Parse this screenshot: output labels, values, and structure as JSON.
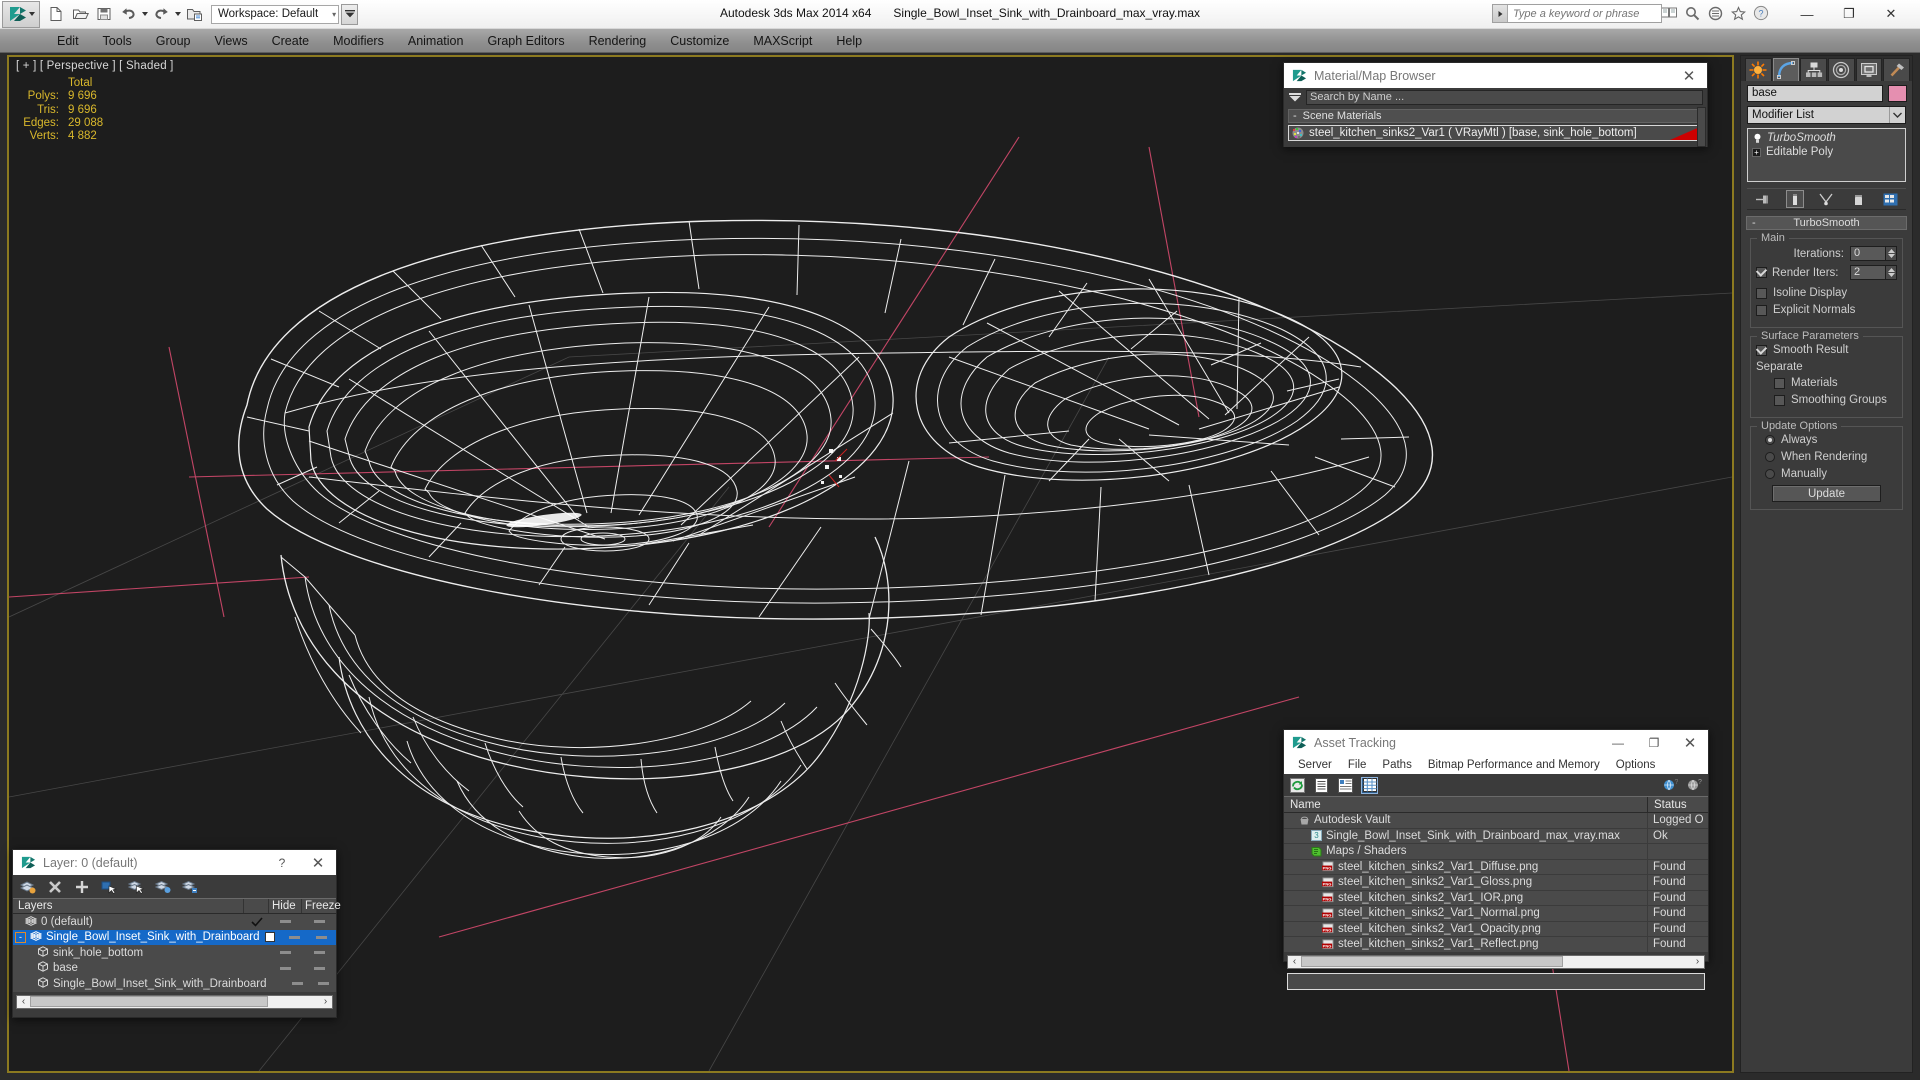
{
  "titlebar": {
    "app_title": "Autodesk 3ds Max  2014 x64",
    "file_name": "Single_Bowl_Inset_Sink_with_Drainboard_max_vray.max",
    "workspace_label": "Workspace: Default",
    "search_placeholder": "Type a keyword or phrase",
    "quick_access": [
      {
        "name": "new-file-icon",
        "label": "New"
      },
      {
        "name": "open-file-icon",
        "label": "Open"
      },
      {
        "name": "save-file-icon",
        "label": "Save"
      },
      {
        "name": "undo-icon",
        "label": "Undo"
      },
      {
        "name": "undo-dropdown-icon",
        "label": "Undo list"
      },
      {
        "name": "redo-icon",
        "label": "Redo"
      },
      {
        "name": "redo-dropdown-icon",
        "label": "Redo list"
      },
      {
        "name": "set-project-folder-icon",
        "label": "Set Project Folder"
      }
    ],
    "window_controls": [
      {
        "name": "minimize-button",
        "glyph": "—"
      },
      {
        "name": "maximize-button",
        "glyph": "❐"
      },
      {
        "name": "close-button",
        "glyph": "✕"
      }
    ]
  },
  "menubar": {
    "items": [
      "Edit",
      "Tools",
      "Group",
      "Views",
      "Create",
      "Modifiers",
      "Animation",
      "Graph Editors",
      "Rendering",
      "Customize",
      "MAXScript",
      "Help"
    ]
  },
  "viewport": {
    "label": "[ + ] [ Perspective ] [ Shaded ]",
    "stats_header": "Total",
    "stats": [
      {
        "label": "Polys:",
        "value": "9 696"
      },
      {
        "label": "Tris:",
        "value": "9 696"
      },
      {
        "label": "Edges:",
        "value": "29 088"
      },
      {
        "label": "Verts:",
        "value": "4 882"
      }
    ],
    "border_color": "#8c7a20",
    "background_color": "#1d1d1d",
    "wire_color": "#ffffff"
  },
  "command_panel": {
    "tabs": [
      {
        "name": "create-tab",
        "label": "Create",
        "active": false
      },
      {
        "name": "modify-tab",
        "label": "Modify",
        "active": true
      },
      {
        "name": "hierarchy-tab",
        "label": "Hierarchy",
        "active": false
      },
      {
        "name": "motion-tab",
        "label": "Motion",
        "active": false
      },
      {
        "name": "display-tab",
        "label": "Display",
        "active": false
      },
      {
        "name": "utilities-tab",
        "label": "Utilities",
        "active": false
      }
    ],
    "object_name": "base",
    "object_color": "#e58fb0",
    "modifier_list_label": "Modifier List",
    "modifier_stack": [
      {
        "label": "TurboSmooth",
        "italic": true
      },
      {
        "label": "Editable Poly",
        "italic": false
      }
    ],
    "stack_tools": [
      {
        "name": "pin-stack-icon"
      },
      {
        "name": "show-end-result-icon"
      },
      {
        "name": "make-unique-icon"
      },
      {
        "name": "remove-modifier-icon"
      },
      {
        "name": "configure-modifier-sets-icon"
      }
    ],
    "turbosmooth": {
      "rollout_title": "TurboSmooth",
      "main_group": "Main",
      "iterations_label": "Iterations:",
      "iterations_value": "0",
      "render_iters_label": "Render Iters:",
      "render_iters_value": "2",
      "render_iters_checked": true,
      "isoline_display_label": "Isoline Display",
      "isoline_display_checked": false,
      "explicit_normals_label": "Explicit Normals",
      "explicit_normals_checked": false,
      "surface_group": "Surface Parameters",
      "smooth_result_label": "Smooth Result",
      "smooth_result_checked": true,
      "separate_label": "Separate",
      "materials_label": "Materials",
      "materials_checked": false,
      "smoothing_groups_label": "Smoothing Groups",
      "smoothing_groups_checked": false,
      "update_group": "Update Options",
      "update_options": [
        {
          "label": "Always",
          "selected": true
        },
        {
          "label": "When Rendering",
          "selected": false
        },
        {
          "label": "Manually",
          "selected": false
        }
      ],
      "update_button": "Update"
    }
  },
  "material_browser": {
    "title": "Material/Map Browser",
    "close_glyph": "✕",
    "search_placeholder": "Search by Name ...",
    "group_label": "Scene Materials",
    "group_collapse_glyph": "-",
    "items": [
      {
        "label": "steel_kitchen_sinks2_Var1 ( VRayMtl ) [base, sink_hole_bottom]",
        "selected": true,
        "flag_color": "#cc0000"
      }
    ]
  },
  "asset_tracking": {
    "title": "Asset Tracking",
    "window_controls": [
      {
        "name": "minimize-button",
        "glyph": "—"
      },
      {
        "name": "maximize-button",
        "glyph": "❐"
      },
      {
        "name": "close-button",
        "glyph": "✕"
      }
    ],
    "menu": [
      "Server",
      "File",
      "Paths",
      "Bitmap Performance and Memory",
      "Options"
    ],
    "toolbar": [
      {
        "name": "refresh-icon",
        "selected": false
      },
      {
        "name": "list-view-icon",
        "selected": false
      },
      {
        "name": "details-view-icon",
        "selected": false
      },
      {
        "name": "grid-view-icon",
        "selected": true
      },
      {
        "name": "help-globe-icon",
        "selected": false
      },
      {
        "name": "help-icon",
        "selected": false
      }
    ],
    "columns": [
      "Name",
      "Status"
    ],
    "rows": [
      {
        "name": "Autodesk Vault",
        "status": "Logged O",
        "indent": 1,
        "icon": "vault-icon"
      },
      {
        "name": "Single_Bowl_Inset_Sink_with_Drainboard_max_vray.max",
        "status": "Ok",
        "indent": 2,
        "icon": "max-file-icon"
      },
      {
        "name": "Maps / Shaders",
        "status": "",
        "indent": 2,
        "icon": "maps-shaders-icon"
      },
      {
        "name": "steel_kitchen_sinks2_Var1_Diffuse.png",
        "status": "Found",
        "indent": 3,
        "icon": "png-icon"
      },
      {
        "name": "steel_kitchen_sinks2_Var1_Gloss.png",
        "status": "Found",
        "indent": 3,
        "icon": "png-icon"
      },
      {
        "name": "steel_kitchen_sinks2_Var1_IOR.png",
        "status": "Found",
        "indent": 3,
        "icon": "png-icon"
      },
      {
        "name": "steel_kitchen_sinks2_Var1_Normal.png",
        "status": "Found",
        "indent": 3,
        "icon": "png-icon"
      },
      {
        "name": "steel_kitchen_sinks2_Var1_Opacity.png",
        "status": "Found",
        "indent": 3,
        "icon": "png-icon"
      },
      {
        "name": "steel_kitchen_sinks2_Var1_Reflect.png",
        "status": "Found",
        "indent": 3,
        "icon": "png-icon"
      }
    ],
    "scroll_left_glyph": "‹",
    "scroll_right_glyph": "›"
  },
  "layer_window": {
    "title": "Layer: 0 (default)",
    "help_glyph": "?",
    "close_glyph": "✕",
    "toolbar": [
      {
        "name": "create-new-layer-icon"
      },
      {
        "name": "delete-layer-icon"
      },
      {
        "name": "add-selection-to-layer-icon"
      },
      {
        "name": "select-objects-in-layer-icon"
      },
      {
        "name": "select-highlighted-objects-icon"
      },
      {
        "name": "highlight-selected-objects-icon"
      },
      {
        "name": "hide-unhide-layer-icon"
      }
    ],
    "columns": [
      "Layers",
      "",
      "Hide",
      "Freeze"
    ],
    "rows": [
      {
        "name": "0 (default)",
        "indent": 1,
        "selected": false,
        "expander": "",
        "current": true,
        "icon": "layer-icon"
      },
      {
        "name": "Single_Bowl_Inset_Sink_with_Drainboard",
        "indent": 0,
        "selected": true,
        "expander": "-",
        "current": false,
        "icon": "layer-icon"
      },
      {
        "name": "sink_hole_bottom",
        "indent": 2,
        "selected": false,
        "expander": "",
        "current": false,
        "icon": "object-icon"
      },
      {
        "name": "base",
        "indent": 2,
        "selected": false,
        "expander": "",
        "current": false,
        "icon": "object-icon"
      },
      {
        "name": "Single_Bowl_Inset_Sink_with_Drainboard",
        "indent": 2,
        "selected": false,
        "expander": "",
        "current": false,
        "icon": "object-icon"
      }
    ],
    "scroll_left_glyph": "‹",
    "scroll_right_glyph": "›"
  }
}
